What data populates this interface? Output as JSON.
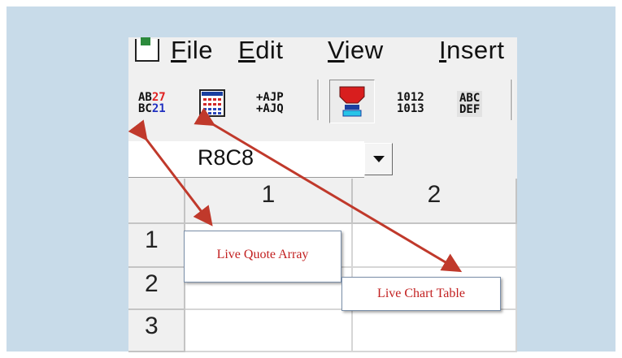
{
  "menu": {
    "file": {
      "u": "F",
      "rest": "ile"
    },
    "edit": {
      "u": "E",
      "rest": "dit"
    },
    "view": {
      "u": "V",
      "rest": "iew"
    },
    "insert": {
      "u": "I",
      "rest": "nsert"
    }
  },
  "toolbar": {
    "quote_array": {
      "l1a": "AB",
      "l1b": "27",
      "l2a": "BC",
      "l2b": "21"
    },
    "symbols": {
      "l1": "+AJP",
      "l2": "+AJQ"
    },
    "numbers": {
      "l1": "1012",
      "l2": "1013"
    },
    "letters": {
      "l1": "ABC",
      "l2": "DEF"
    }
  },
  "namebox": {
    "value": "R8C8"
  },
  "grid": {
    "columns": [
      "1",
      "2"
    ],
    "rows": [
      "1",
      "2",
      "3"
    ]
  },
  "callouts": {
    "quote_array": "Live Quote Array",
    "chart_table": "Live Chart Table"
  },
  "colors": {
    "arrow": "#c0392b",
    "callout_text": "#c22020",
    "frame": "#c8dbe9"
  },
  "icons": [
    "excel-app-icon",
    "chart-table-icon",
    "download-icon",
    "dropdown-arrow-icon"
  ]
}
